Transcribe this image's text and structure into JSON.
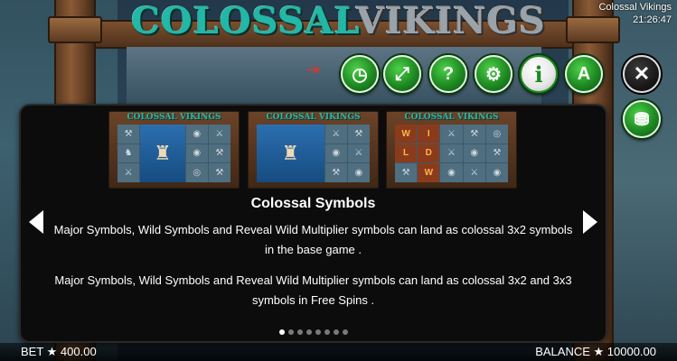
{
  "game": {
    "logo_part1": "COLOSSAL",
    "logo_part2": "VIKINGS",
    "window_title": "Colossal Vikings",
    "time": "21:26:47"
  },
  "toolbar": {
    "exit_icon": "exit-icon",
    "buttons": [
      {
        "name": "history-button",
        "icon": "clock-icon",
        "glyph": "◷"
      },
      {
        "name": "fullscreen-button",
        "icon": "expand-arrows-icon",
        "glyph": "⤢"
      },
      {
        "name": "help-button",
        "icon": "question-icon",
        "glyph": "?"
      },
      {
        "name": "settings-button",
        "icon": "gear-icon",
        "glyph": "⚙"
      },
      {
        "name": "info-button",
        "icon": "info-icon",
        "glyph": "i"
      },
      {
        "name": "autoplay-button",
        "icon": "autoplay-icon",
        "glyph": "A"
      }
    ],
    "close_glyph": "✕",
    "coins_glyph": "⛃"
  },
  "info_panel": {
    "thumb_title": "COLOSSAL VIKINGS",
    "title": "Colossal Symbols",
    "paragraph1": "Major Symbols, Wild Symbols and Reveal Wild Multiplier symbols can land as colossal 3x2 symbols in the base game .",
    "paragraph2": "Major Symbols, Wild Symbols and Reveal Wild Multiplier symbols can land as colossal 3x2 and 3x3 symbols in Free Spins .",
    "page_count": 8,
    "active_page": 0
  },
  "footer": {
    "bet_label": "BET ★ 400.00",
    "balance_label": "BALANCE ★ 10000.00"
  },
  "colors": {
    "accent_green": "#1e8a22",
    "logo_teal": "#22b8a8",
    "panel_bg": "#0c0c0c"
  }
}
